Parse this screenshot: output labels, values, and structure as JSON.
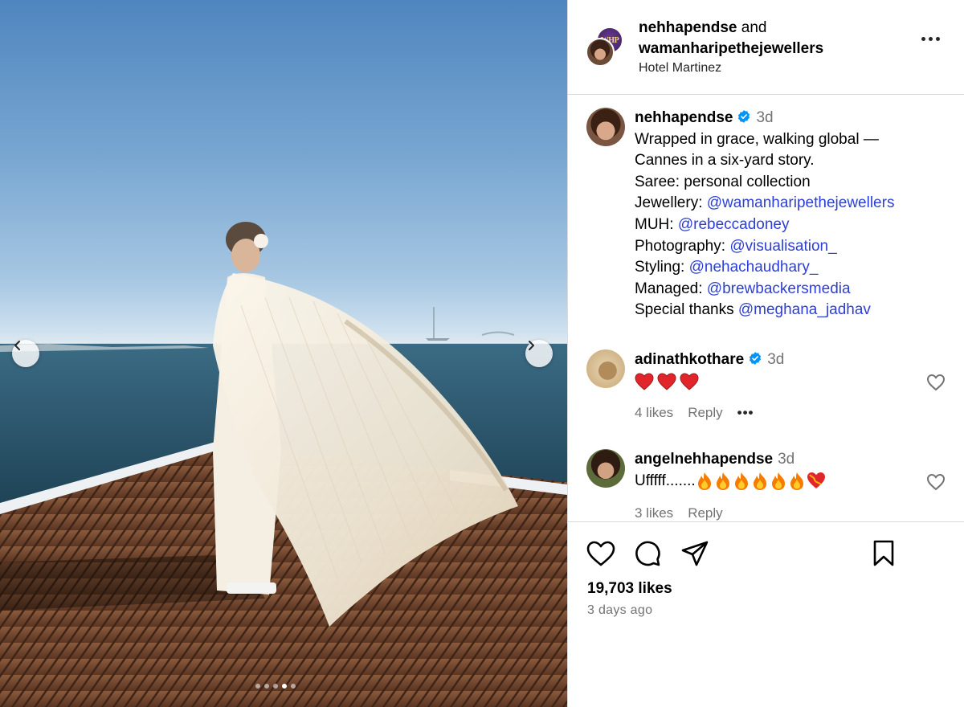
{
  "post": {
    "header": {
      "author": "nehhapendse",
      "joiner": "and",
      "collaborator": "wamanharipethejewellers",
      "location": "Hotel Martinez",
      "brand_initials": "WHP"
    },
    "carousel": {
      "slides": 5,
      "active_index": 3
    },
    "caption": {
      "author": "nehhapendse",
      "time": "3d",
      "line1": "Wrapped in grace, walking global —",
      "line2": "Cannes in a six-yard story.",
      "line3": "Saree: personal collection",
      "rows": [
        {
          "label": "Jewellery:",
          "mention": "@wamanharipethejewellers"
        },
        {
          "label": "MUH:",
          "mention": "@rebeccadoney"
        },
        {
          "label": "Photography:",
          "mention": "@visualisation_"
        },
        {
          "label": "Styling:",
          "mention": "@nehachaudhary_"
        },
        {
          "label": "Managed:",
          "mention": "@brewbackersmedia"
        },
        {
          "label": "Special thanks",
          "mention": "@meghana_jadhav"
        }
      ]
    },
    "comments": [
      {
        "user": "adinathkothare",
        "time": "3d",
        "text_emoji": "❤️❤️❤️",
        "likes": "4 likes",
        "reply": "Reply",
        "more": "•••"
      },
      {
        "user": "angelnehhapendse",
        "time": "3d",
        "text": "Ufffff.......",
        "text_emoji": "🔥🔥🔥🔥🔥🔥❤️‍🔥",
        "likes": "3 likes",
        "reply": "Reply"
      }
    ],
    "likes": "19,703 likes",
    "posted": "3 days ago",
    "icons": [
      "heart-icon",
      "comment-icon",
      "share-icon",
      "bookmark-icon",
      "verified-icon",
      "more-icon",
      "chevron-left-icon",
      "chevron-right-icon"
    ]
  }
}
